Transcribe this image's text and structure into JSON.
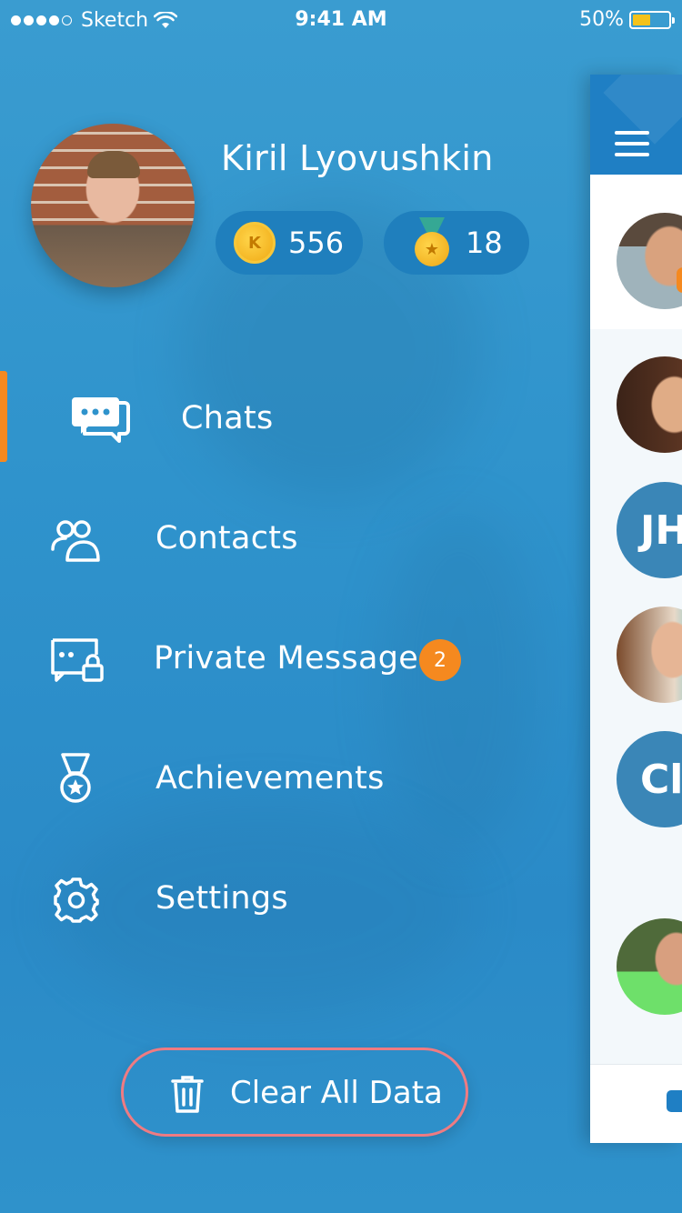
{
  "status_bar": {
    "carrier": "Sketch",
    "time": "9:41 AM",
    "battery": "50%",
    "battery_level": 0.5,
    "signal_icon": "signal-dots-icon",
    "wifi_icon": "wifi-icon"
  },
  "profile": {
    "name": "Kiril Lyovushkin",
    "coins": "556",
    "coin_letter": "K",
    "medals": "18"
  },
  "menu": {
    "items": [
      {
        "label": "Chats",
        "icon": "chat-bubbles-icon",
        "active": true
      },
      {
        "label": "Contacts",
        "icon": "contacts-icon"
      },
      {
        "label": "Private Message",
        "icon": "private-message-icon",
        "badge": "2"
      },
      {
        "label": "Achievements",
        "icon": "medal-icon"
      },
      {
        "label": "Settings",
        "icon": "gear-icon"
      }
    ]
  },
  "actions": {
    "clear_all": "Clear All Data"
  },
  "panel": {
    "initials_1": "JH",
    "initials_2": "Cl"
  },
  "colors": {
    "background": "#2f93cc",
    "accent_orange": "#f5891f",
    "pill_bg": "#1f7fbd",
    "danger_border": "#ef7b82"
  }
}
